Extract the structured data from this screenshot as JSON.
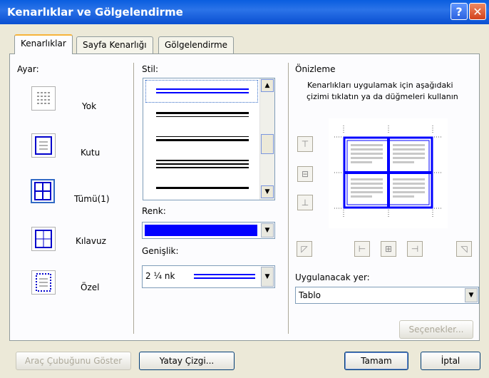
{
  "window": {
    "title": "Kenarlıklar ve Gölgelendirme",
    "help_glyph": "?",
    "close_glyph": "✕"
  },
  "tabs": [
    {
      "label": "Kenarlıklar",
      "active": true
    },
    {
      "label": "Sayfa Kenarlığı",
      "active": false
    },
    {
      "label": "Gölgelendirme",
      "active": false
    }
  ],
  "ayar": {
    "label": "Ayar:",
    "items": [
      {
        "label": "Yok",
        "icon": "none-border-icon"
      },
      {
        "label": "Kutu",
        "icon": "box-border-icon"
      },
      {
        "label": "Tümü(1)",
        "icon": "all-border-icon",
        "selected": true
      },
      {
        "label": "Kılavuz",
        "icon": "grid-border-icon"
      },
      {
        "label": "Özel",
        "icon": "custom-border-icon"
      }
    ]
  },
  "stil": {
    "label": "Stil:"
  },
  "renk": {
    "label": "Renk:",
    "value_color": "#0000ff"
  },
  "genislik": {
    "label": "Genişlik:",
    "value": "2 ¼ nk"
  },
  "onizleme": {
    "label": "Önizleme",
    "hint_line1": "Kenarlıkları uygulamak için aşağıdaki",
    "hint_line2": "çizimi tıklatın ya da düğmeleri kullanın"
  },
  "uygulanacak": {
    "label": "Uygulanacak yer:",
    "value": "Tablo"
  },
  "buttons": {
    "secenekler": "Seçenekler...",
    "arac_cubugu": "Araç Çubuğunu Göster",
    "yatay_cizgi": "Yatay Çizgi...",
    "tamam": "Tamam",
    "iptal": "İptal"
  },
  "colors": {
    "accent_blue": "#0000ff",
    "titlebar": "#0a5ddf"
  }
}
